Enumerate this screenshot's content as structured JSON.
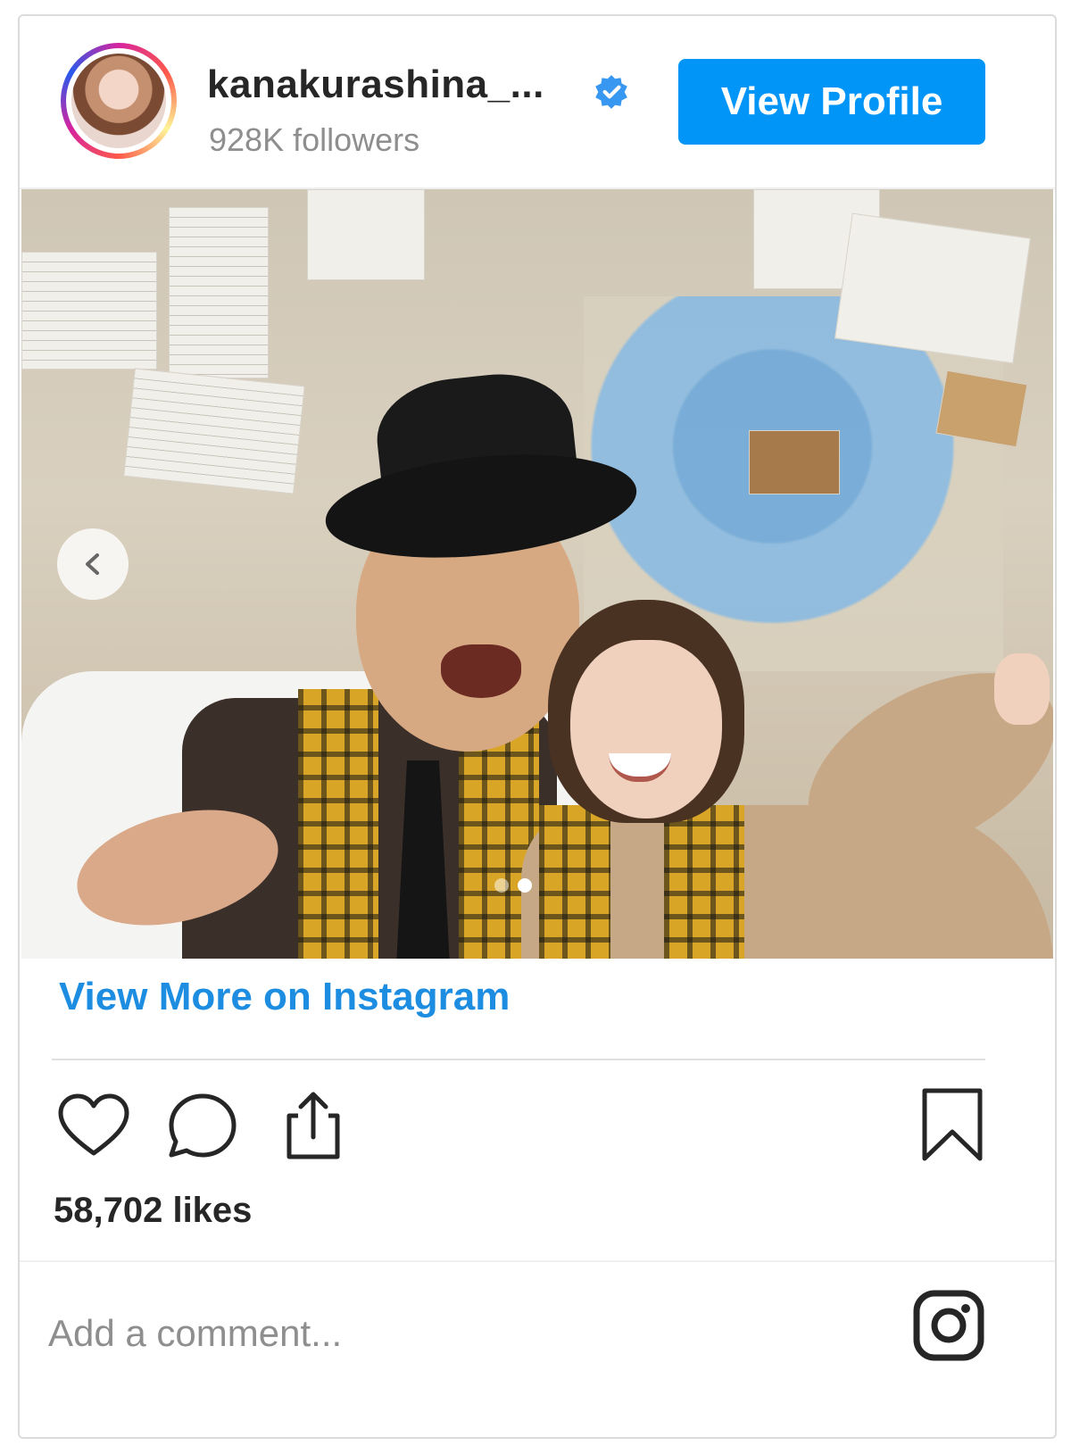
{
  "header": {
    "username": "kanakurashina_...",
    "followers": "928K followers",
    "view_profile_label": "View Profile"
  },
  "post": {
    "image_alt": "Photo of two people posing in a detective-themed office set",
    "carousel": {
      "total_slides": 2,
      "active_slide": 2
    }
  },
  "links": {
    "view_more_label": "View More on Instagram"
  },
  "engagement": {
    "likes": "58,702 likes"
  },
  "comment": {
    "placeholder": "Add a comment..."
  },
  "icons": [
    "verified-badge-icon",
    "chevron-left-icon",
    "heart-icon",
    "comment-icon",
    "share-icon",
    "bookmark-icon",
    "instagram-logo-icon"
  ],
  "colors": {
    "accent_blue": "#0095f6",
    "link_blue": "#1c8de0",
    "text_primary": "#262626",
    "text_secondary": "#8e8e8e"
  }
}
